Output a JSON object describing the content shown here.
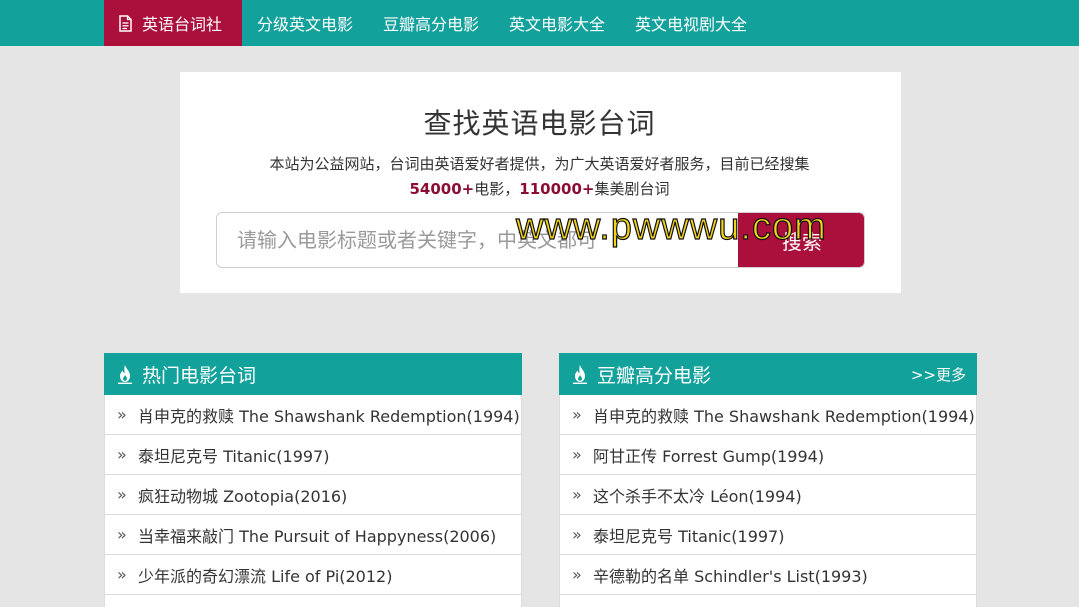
{
  "nav": {
    "items": [
      {
        "label": "英语台词社",
        "icon": "document-icon",
        "active": true
      },
      {
        "label": "分级英文电影"
      },
      {
        "label": "豆瓣高分电影"
      },
      {
        "label": "英文电影大全"
      },
      {
        "label": "英文电视剧大全"
      }
    ]
  },
  "search": {
    "title": "查找英语电影台词",
    "desc": "本站为公益网站，台词由英语爱好者提供，为广大英语爱好者服务，目前已经搜集",
    "movies_count": "54000+",
    "movies_label": "电影，",
    "episodes_count": "110000+",
    "episodes_label": "集美剧台词",
    "placeholder": "请输入电影标题或者关键字，中英文都可",
    "button_label": "搜索"
  },
  "watermark": "www.pwwwu.com",
  "hot_panel": {
    "title": "热门电影台词",
    "icon": "fire-icon",
    "items": [
      "肖申克的救赎 The Shawshank Redemption(1994)",
      "泰坦尼克号 Titanic(1997)",
      "疯狂动物城 Zootopia(2016)",
      "当幸福来敲门 The Pursuit of Happyness(2006)",
      "少年派的奇幻漂流 Life of Pi(2012)"
    ]
  },
  "douban_panel": {
    "title": "豆瓣高分电影",
    "icon": "fire-icon",
    "more_label": ">>更多",
    "items": [
      "肖申克的救赎 The Shawshank Redemption(1994)",
      "阿甘正传 Forrest Gump(1994)",
      "这个杀手不太冷 Léon(1994)",
      "泰坦尼克号 Titanic(1997)",
      "辛德勒的名单 Schindler's List(1993)"
    ]
  },
  "colors": {
    "teal": "#13a19c",
    "crimson": "#ab0f3c",
    "background": "#e5e5e5"
  }
}
